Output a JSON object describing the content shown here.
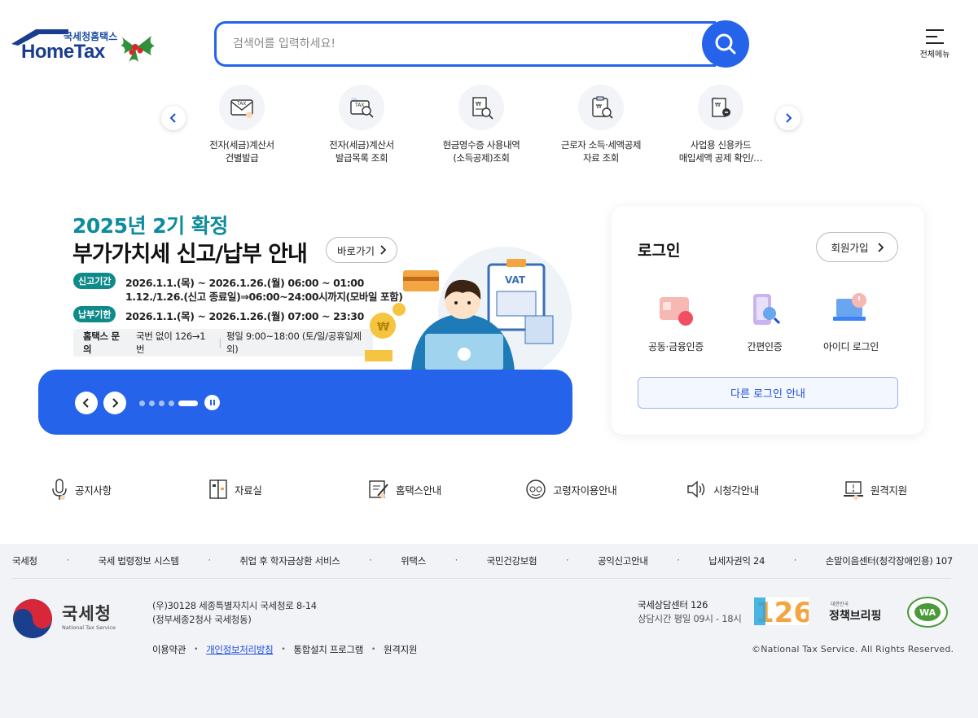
{
  "header": {
    "logo_sub": "국세청홈택스",
    "logo_main": "HomeTax",
    "search_placeholder": "검색어를 입력하세요!",
    "all_menu_label": "전체메뉴"
  },
  "quick_menu": [
    {
      "line1": "전자(세금)계산서",
      "line2": "건별발급",
      "icon": "tax-envelope-icon"
    },
    {
      "line1": "전자(세금)계산서",
      "line2": "발급목록 조회",
      "icon": "tax-search-icon"
    },
    {
      "line1": "현금영수증 사용내역",
      "line2": "(소득공제)조회",
      "icon": "receipt-search-icon"
    },
    {
      "line1": "근로자 소득·세액공제",
      "line2": "자료 조회",
      "icon": "clipboard-search-icon"
    },
    {
      "line1": "사업용 신용카드",
      "line2": "매입세액 공제 확인/…",
      "icon": "card-receipt-icon"
    }
  ],
  "banner": {
    "title1": "2025년 2기 확정",
    "title2": "부가가치세 신고/납부 안내",
    "goto_label": "바로가기",
    "tag1": "신고기간",
    "line1": "2026.1.1.(목) ~ 2026.1.26.(월) 06:00 ~ 01:00",
    "line2": "1.12./1.26.(신고 종료일)⇒06:00~24:00시까지(모바일 포함)",
    "tag2": "납부기한",
    "line3": "2026.1.1.(목) ~ 2026.1.26.(월) 07:00 ~ 23:30",
    "inquiry_label": "홈택스 문의",
    "inquiry_text1": "국번 없이 126→1번",
    "inquiry_text2": "평일 9:00~18:00 (토/일/공휴일제외)",
    "illus_vat": "VAT",
    "slide_count": 5,
    "active_slide": 5
  },
  "login": {
    "title": "로그인",
    "join_label": "회원가입",
    "options": [
      {
        "label": "공동·금융인증"
      },
      {
        "label": "간편인증"
      },
      {
        "label": "아이디 로그인"
      }
    ],
    "other_label": "다른 로그인 안내"
  },
  "shortcuts": [
    {
      "label": "공지사항",
      "icon": "microphone-icon"
    },
    {
      "label": "자료실",
      "icon": "archive-icon"
    },
    {
      "label": "홈택스안내",
      "icon": "guide-edit-icon"
    },
    {
      "label": "고령자이용안내",
      "icon": "elderly-icon"
    },
    {
      "label": "시청각안내",
      "icon": "speaker-icon"
    },
    {
      "label": "원격지원",
      "icon": "laptop-icon"
    }
  ],
  "footer": {
    "links": [
      "국세청",
      "국세 법령정보 시스템",
      "취업 후 학자금상환 서비스",
      "위택스",
      "국민건강보험",
      "공익신고안내",
      "납세자권익 24",
      "손말이음센터(청각장애인용) 107"
    ],
    "nts_name": "국세청",
    "nts_en": "National Tax Service",
    "address1": "(우)30128 세종특별자치시 국세청로 8-14",
    "address2": "(정부세종2청사 국세청동)",
    "bottom_links": [
      "이용약관",
      "개인정보처리방침",
      "통합설치 프로그램",
      "원격지원"
    ],
    "center_title": "국세상담센터 126",
    "center_hours": "상담시간 평일 09시 - 18시",
    "badge_126": "126",
    "policy_small": "대한민국",
    "policy_text": "정책브리핑",
    "wa_text": "WA",
    "copyright": "©National Tax Service. All Rights Reserved."
  },
  "colors": {
    "primary": "#2563eb",
    "teal": "#0e8b9c",
    "footer_bg": "#f2f3f7"
  }
}
